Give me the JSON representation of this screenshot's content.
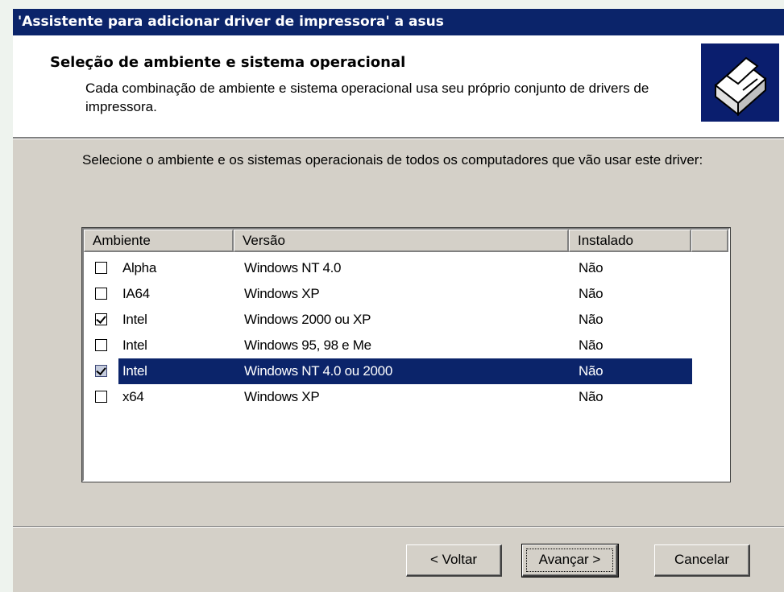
{
  "window": {
    "title": "'Assistente para adicionar driver de impressora' a asus"
  },
  "header": {
    "title": "Seleção de ambiente e sistema operacional",
    "description": "Cada combinação de ambiente e sistema operacional usa seu próprio conjunto de drivers de impressora.",
    "icon": "printer-icon"
  },
  "instruction": "Selecione o ambiente e os sistemas operacionais de todos os computadores que vão usar este driver:",
  "list": {
    "columns": [
      "Ambiente",
      "Versão",
      "Instalado"
    ],
    "rows": [
      {
        "ambiente": "Alpha",
        "versao": "Windows NT 4.0",
        "instalado": "Não",
        "checked": false,
        "selected": false
      },
      {
        "ambiente": "IA64",
        "versao": "Windows XP",
        "instalado": "Não",
        "checked": false,
        "selected": false
      },
      {
        "ambiente": "Intel",
        "versao": "Windows 2000 ou XP",
        "instalado": "Não",
        "checked": true,
        "selected": false
      },
      {
        "ambiente": "Intel",
        "versao": "Windows 95, 98 e Me",
        "instalado": "Não",
        "checked": false,
        "selected": false
      },
      {
        "ambiente": "Intel",
        "versao": "Windows NT 4.0 ou 2000",
        "instalado": "Não",
        "checked": true,
        "selected": true
      },
      {
        "ambiente": "x64",
        "versao": "Windows XP",
        "instalado": "Não",
        "checked": false,
        "selected": false
      }
    ]
  },
  "buttons": {
    "back": "< Voltar",
    "next": "Avançar >",
    "cancel": "Cancelar"
  },
  "colors": {
    "titlebar": "#0b246a",
    "selection": "#0b246a",
    "face": "#d4d0c8"
  }
}
